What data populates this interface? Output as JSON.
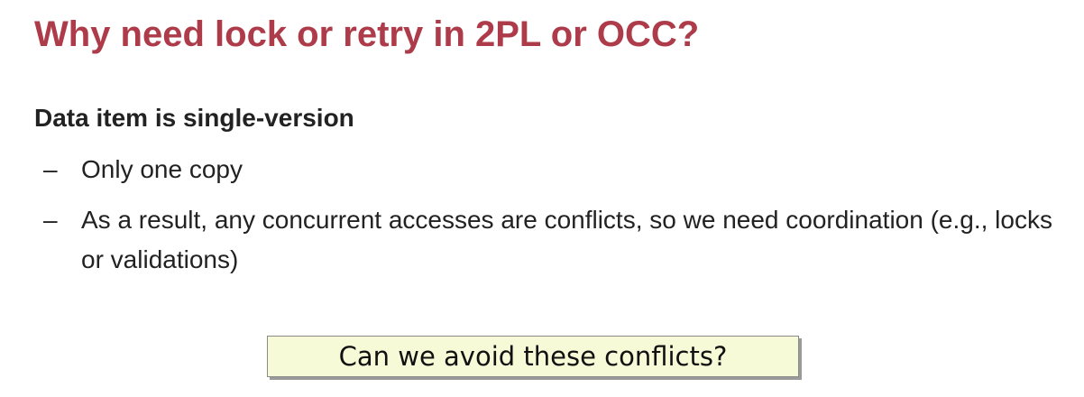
{
  "slide": {
    "title": "Why need lock or retry in 2PL or OCC?",
    "heading": "Data item is single-version",
    "bullet_marker": "–",
    "bullets": [
      "Only one copy",
      "As a result, any concurrent accesses are conflicts, so we need coordination (e.g., locks or validations)"
    ],
    "callout": "Can we avoid these conflicts?"
  },
  "colors": {
    "title": "#ad3b4a",
    "text": "#222222",
    "callout_background": "#f7fad6"
  }
}
